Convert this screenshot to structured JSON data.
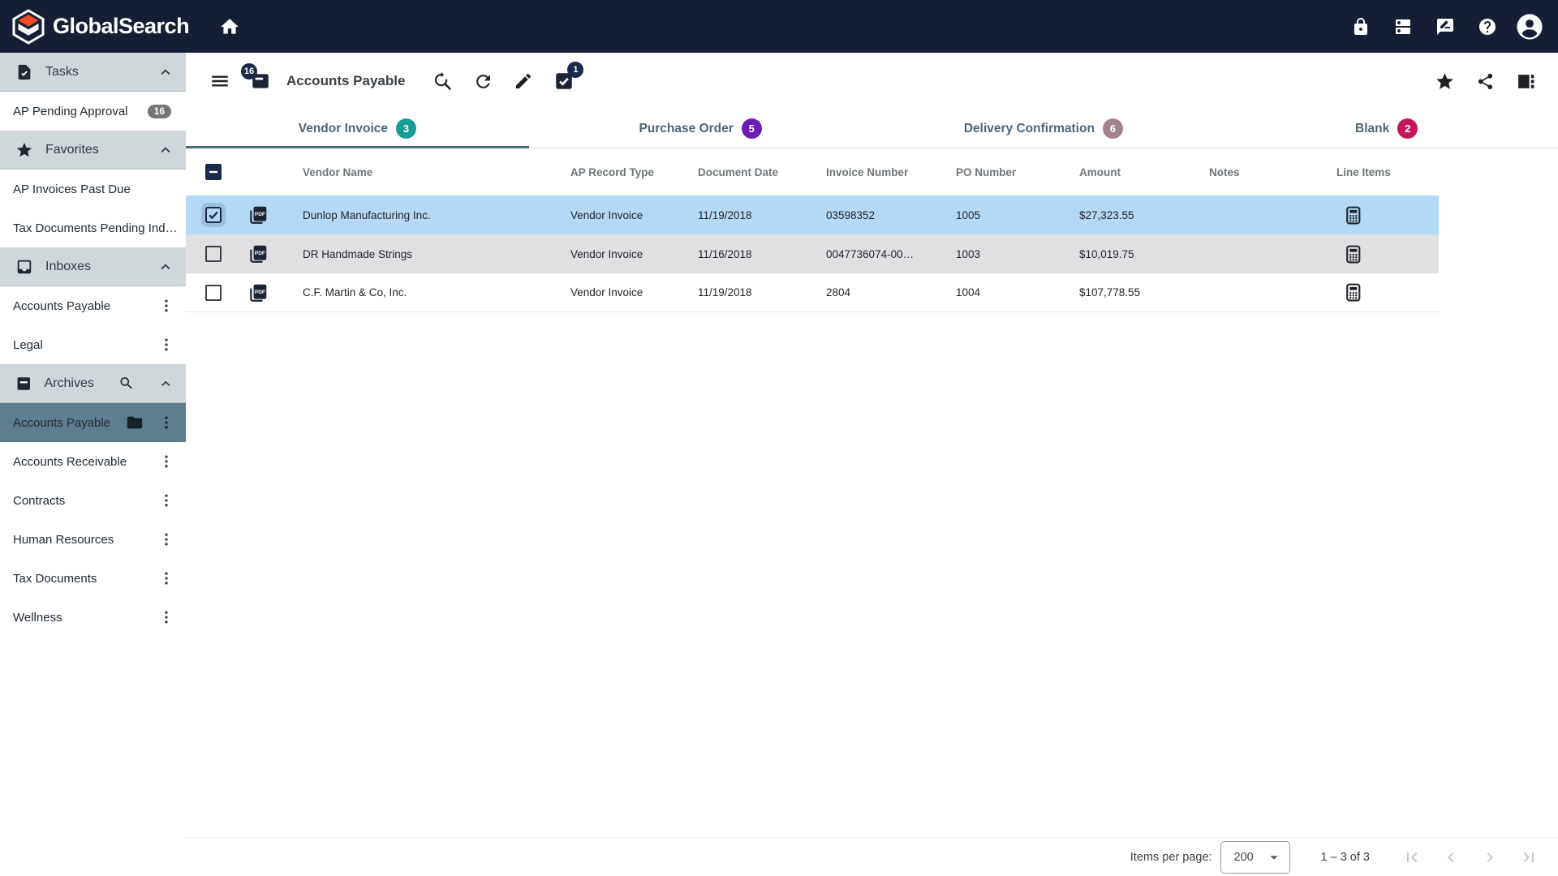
{
  "colors": {
    "navbar_bg": "#161e36",
    "logo_orange": "#f04e23",
    "sidebar_header_bg": "#cfd7db",
    "sidebar_selected_bg": "#5d7e8e",
    "selected_row_bg": "#b3d9f6",
    "alt_row_bg": "#e0e0e3",
    "tab_underline": "#4e6a79",
    "badge_teal": "#1a9c94",
    "badge_purple": "#6a1cb5",
    "badge_mauve": "#a5818e",
    "badge_pink": "#c2185b",
    "count_badge_navy": "#1b2a4a",
    "count_badge_gray": "#757575"
  },
  "navbar": {
    "brand": "GlobalSearch",
    "icons": [
      "home-icon",
      "lock-icon",
      "dns-icon",
      "feedback-icon",
      "help-icon",
      "account-avatar"
    ]
  },
  "sidebar": {
    "sections": [
      {
        "label": "Tasks",
        "icon": "task-icon",
        "items": [
          {
            "label": "AP Pending Approval",
            "badge": "16"
          }
        ]
      },
      {
        "label": "Favorites",
        "icon": "star-icon",
        "items": [
          {
            "label": "AP Invoices Past Due"
          },
          {
            "label": "Tax Documents Pending Inde…"
          }
        ]
      },
      {
        "label": "Inboxes",
        "icon": "inbox-icon",
        "items": [
          {
            "label": "Accounts Payable"
          },
          {
            "label": "Legal"
          }
        ]
      },
      {
        "label": "Archives",
        "icon": "archive-icon",
        "has_search": true,
        "items": [
          {
            "label": "Accounts Payable",
            "selected": true,
            "icon": "folder-icon"
          },
          {
            "label": "Accounts Receivable"
          },
          {
            "label": "Contracts"
          },
          {
            "label": "Human Resources"
          },
          {
            "label": "Tax Documents"
          },
          {
            "label": "Wellness"
          }
        ]
      }
    ]
  },
  "toolbar": {
    "title": "Accounts Payable",
    "inbox_badge": "16",
    "selected_badge": "1",
    "left_icons": [
      "menu-icon",
      "inbox-filled-icon",
      "search-again-icon",
      "refresh-icon",
      "edit-icon",
      "select-done-icon"
    ],
    "right_icons": [
      "star-icon",
      "share-icon",
      "view-sidebar-icon"
    ]
  },
  "tabs": [
    {
      "label": "Vendor Invoice",
      "count": "3",
      "active": true
    },
    {
      "label": "Purchase Order",
      "count": "5"
    },
    {
      "label": "Delivery Confirmation",
      "count": "6"
    },
    {
      "label": "Blank",
      "count": "2"
    }
  ],
  "table": {
    "columns": [
      "Vendor Name",
      "AP Record Type",
      "Document Date",
      "Invoice Number",
      "PO Number",
      "Amount",
      "Notes",
      "Line Items"
    ],
    "rows": [
      {
        "vendor": "Dunlop Manufacturing Inc.",
        "type": "Vendor Invoice",
        "date": "11/19/2018",
        "invoice": "03598352",
        "po": "1005",
        "amount": "$27,323.55",
        "notes": "",
        "selected": true,
        "checked": true
      },
      {
        "vendor": "DR Handmade Strings",
        "type": "Vendor Invoice",
        "date": "11/16/2018",
        "invoice": "0047736074-00…",
        "po": "1003",
        "amount": "$10,019.75",
        "notes": ""
      },
      {
        "vendor": "C.F. Martin & Co, Inc.",
        "type": "Vendor Invoice",
        "date": "11/19/2018",
        "invoice": "2804",
        "po": "1004",
        "amount": "$107,778.55",
        "notes": ""
      }
    ]
  },
  "pagination": {
    "items_per_page_label": "Items per page:",
    "page_size": "200",
    "range": "1 – 3 of 3"
  }
}
